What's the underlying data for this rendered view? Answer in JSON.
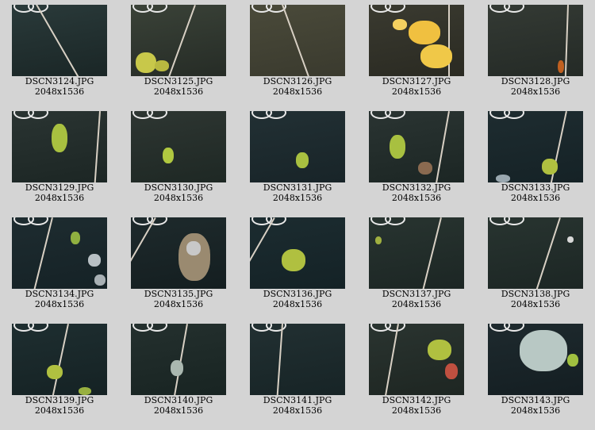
{
  "gallery": {
    "items": [
      {
        "name": "DSCN3124.JPG",
        "dims": "2048x1536",
        "bg": [
          "#2a3a3a",
          "#1a2626"
        ]
      },
      {
        "name": "DSCN3125.JPG",
        "dims": "2048x1536",
        "bg": [
          "#3a4238",
          "#262c26"
        ]
      },
      {
        "name": "DSCN3126.JPG",
        "dims": "2048x1536",
        "bg": [
          "#4a4a3a",
          "#3a3a2e"
        ]
      },
      {
        "name": "DSCN3127.JPG",
        "dims": "2048x1536",
        "bg": [
          "#3a3a30",
          "#2a2a22"
        ]
      },
      {
        "name": "DSCN3128.JPG",
        "dims": "2048x1536",
        "bg": [
          "#343a34",
          "#242a26"
        ]
      },
      {
        "name": "DSCN3129.JPG",
        "dims": "2048x1536",
        "bg": [
          "#2a3432",
          "#1c2624"
        ]
      },
      {
        "name": "DSCN3130.JPG",
        "dims": "2048x1536",
        "bg": [
          "#2e3632",
          "#1e2824"
        ]
      },
      {
        "name": "DSCN3131.JPG",
        "dims": "2048x1536",
        "bg": [
          "#223034",
          "#182428"
        ]
      },
      {
        "name": "DSCN3132.JPG",
        "dims": "2048x1536",
        "bg": [
          "#2a3432",
          "#1c2624"
        ]
      },
      {
        "name": "DSCN3133.JPG",
        "dims": "2048x1536",
        "bg": [
          "#1e2c30",
          "#152226"
        ]
      },
      {
        "name": "DSCN3134.JPG",
        "dims": "2048x1536",
        "bg": [
          "#1e2c30",
          "#152226"
        ]
      },
      {
        "name": "DSCN3135.JPG",
        "dims": "2048x1536",
        "bg": [
          "#1e2a2c",
          "#141e20"
        ]
      },
      {
        "name": "DSCN3136.JPG",
        "dims": "2048x1536",
        "bg": [
          "#1c2c30",
          "#142226"
        ]
      },
      {
        "name": "DSCN3137.JPG",
        "dims": "2048x1536",
        "bg": [
          "#283430",
          "#1c2624"
        ]
      },
      {
        "name": "DSCN3138.JPG",
        "dims": "2048x1536",
        "bg": [
          "#283430",
          "#1c2624"
        ]
      },
      {
        "name": "DSCN3139.JPG",
        "dims": "2048x1536",
        "bg": [
          "#1e2e30",
          "#152224"
        ]
      },
      {
        "name": "DSCN3140.JPG",
        "dims": "2048x1536",
        "bg": [
          "#24302e",
          "#182422"
        ]
      },
      {
        "name": "DSCN3141.JPG",
        "dims": "2048x1536",
        "bg": [
          "#223032",
          "#172426"
        ]
      },
      {
        "name": "DSCN3142.JPG",
        "dims": "2048x1536",
        "bg": [
          "#2a3430",
          "#1e2622"
        ]
      },
      {
        "name": "DSCN3143.JPG",
        "dims": "2048x1536",
        "bg": [
          "#1e2a2e",
          "#141e22"
        ]
      }
    ]
  }
}
